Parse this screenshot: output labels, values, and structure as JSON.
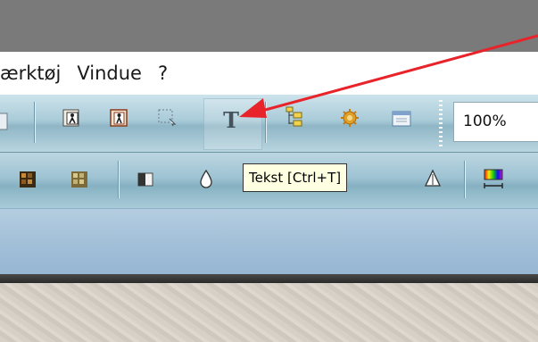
{
  "menubar": {
    "items": [
      "ærktøj",
      "Vindue",
      "?"
    ]
  },
  "toolbar1": {
    "text_tool_glyph": "T",
    "zoom_value": "100%"
  },
  "tooltip": {
    "text": "Tekst [Ctrl+T]"
  },
  "colors": {
    "title_bar": "#7a7a7a",
    "arrow": "#e8232a",
    "tooltip_bg": "#ffffe1"
  },
  "icons": [
    "page-icon",
    "person-frame-icon",
    "person-frame-icon-2",
    "marquee-select-icon",
    "text-tool-icon",
    "tree-folder-icon",
    "settings-gear-icon",
    "window-icon",
    "grid-icon",
    "grid-icon-2",
    "half-fill-icon",
    "drop-icon",
    "triangle-icon",
    "color-palette-icon"
  ]
}
